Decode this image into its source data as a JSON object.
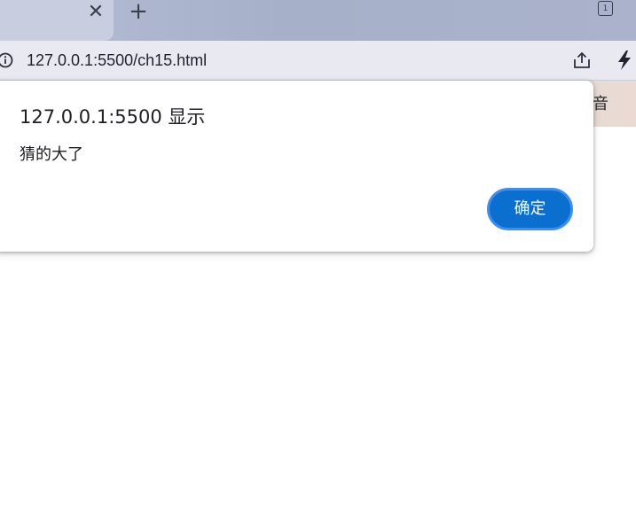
{
  "tabstrip": {
    "close_glyph": "✕",
    "new_tab_glyph": "+",
    "tab_count": "1"
  },
  "addressbar": {
    "url": "127.0.0.1:5500/ch15.html",
    "icons": [
      "info-icon",
      "share-icon",
      "bolt-icon"
    ]
  },
  "page": {
    "banner_text": "音"
  },
  "dialog": {
    "title": "127.0.0.1:5500 显示",
    "message": "猜的大了",
    "ok_label": "确定"
  },
  "colors": {
    "ok_button": "#0b6fd0",
    "ok_button_ring": "#3e8ef0",
    "tabstrip": "#a6b0c9",
    "addressbar": "#e9eaf1"
  }
}
